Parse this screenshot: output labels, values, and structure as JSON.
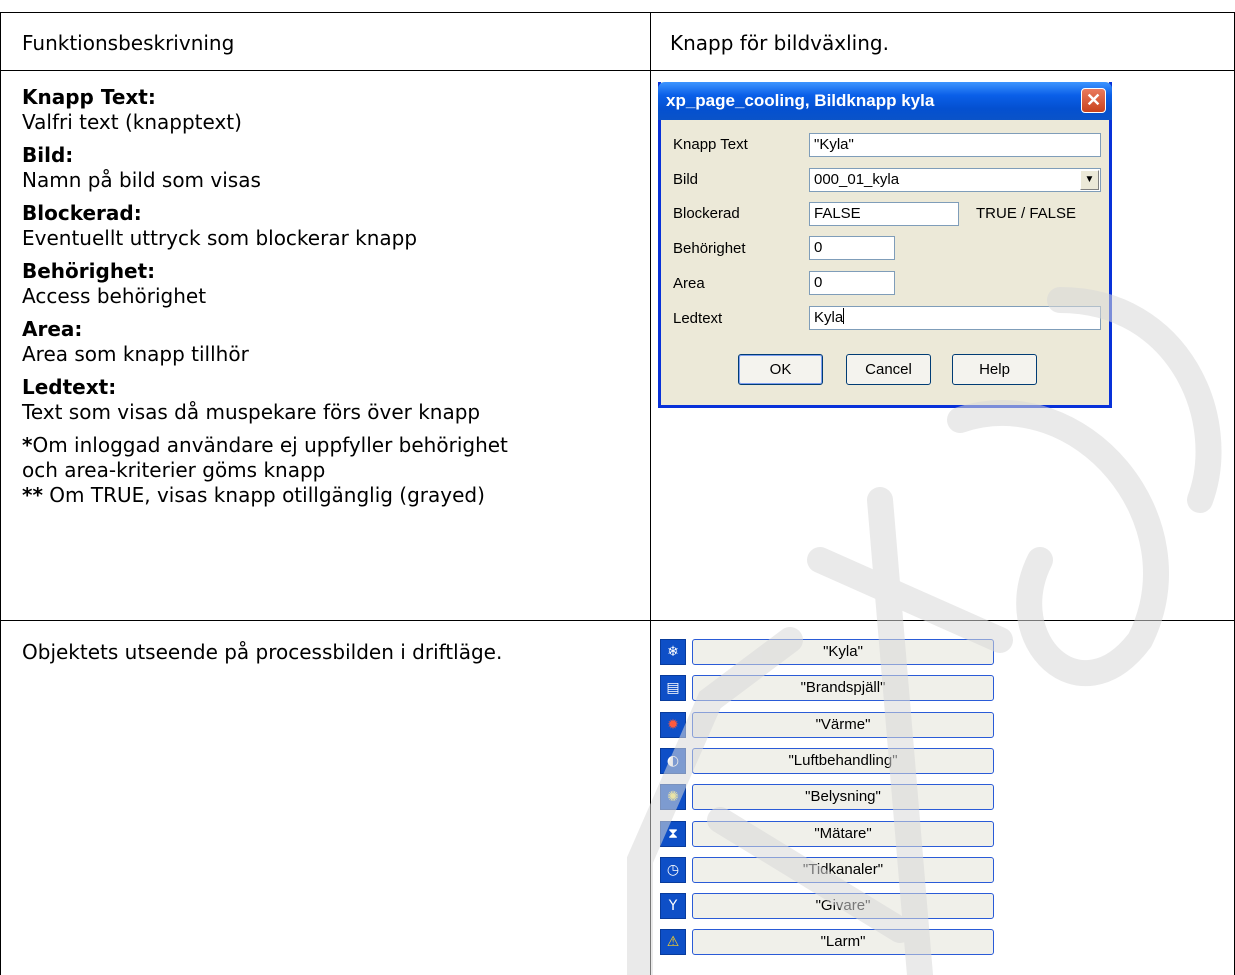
{
  "row1": {
    "left": "Funktionsbeskrivning",
    "right": "Knapp för bildväxling."
  },
  "row2": {
    "fields": [
      {
        "name": "Knapp Text:",
        "desc": "Valfri text (knapptext)"
      },
      {
        "name": "Bild:",
        "desc": "Namn på bild som visas"
      },
      {
        "name": "Blockerad:",
        "desc": "Eventuellt uttryck som blockerar knapp"
      },
      {
        "name": "Behörighet:",
        "desc": "Access behörighet"
      },
      {
        "name": "Area:",
        "desc": "Area som knapp tillhör"
      },
      {
        "name": "Ledtext:",
        "desc": "Text som visas då muspekare förs över knapp"
      }
    ],
    "note1_mark": "*",
    "note1_text": "Om inloggad användare ej uppfyller behörighet",
    "note1_line2": "och area-kriterier göms knapp",
    "note2_mark": "**",
    "note2_text": " Om TRUE, visas knapp otillgänglig (grayed)"
  },
  "dialog": {
    "title": "xp_page_cooling, Bildknapp kyla",
    "close": "✕",
    "labels": {
      "knapp_text": "Knapp Text",
      "bild": "Bild",
      "blockerad": "Blockerad",
      "behorighet": "Behörighet",
      "area": "Area",
      "ledtext": "Ledtext"
    },
    "values": {
      "knapp_text": "\"Kyla\"",
      "bild": "000_01_kyla",
      "blockerad": "FALSE",
      "behorighet": "0",
      "area": "0",
      "ledtext": "Kyla"
    },
    "blockerad_hint": "TRUE / FALSE",
    "buttons": {
      "ok": "OK",
      "cancel": "Cancel",
      "help": "Help"
    }
  },
  "row3": {
    "left": "Objektets utseende på processbilden i driftläge."
  },
  "process_buttons": [
    {
      "label": "\"Kyla\"",
      "icon": "snowflake-icon",
      "glyph": "❄"
    },
    {
      "label": "\"Brandspjäll\"",
      "icon": "fire-damper-icon",
      "glyph": "▤"
    },
    {
      "label": "\"Värme\"",
      "icon": "heat-icon",
      "glyph": "✹"
    },
    {
      "label": "\"Luftbehandling\"",
      "icon": "air-handling-icon",
      "glyph": "◐"
    },
    {
      "label": "\"Belysning\"",
      "icon": "lightbulb-icon",
      "glyph": "✺"
    },
    {
      "label": "\"Mätare\"",
      "icon": "meter-icon",
      "glyph": "⧗"
    },
    {
      "label": "\"Tidkanaler\"",
      "icon": "clock-icon",
      "glyph": "◷"
    },
    {
      "label": "\"Givare\"",
      "icon": "sensor-icon",
      "glyph": "Y"
    },
    {
      "label": "\"Larm\"",
      "icon": "warning-icon",
      "glyph": "⚠"
    }
  ],
  "colors": {
    "dialog_title": "#0a5fe8",
    "icon_bg": "#0e4fc7",
    "button_border": "#2a5bd7"
  }
}
